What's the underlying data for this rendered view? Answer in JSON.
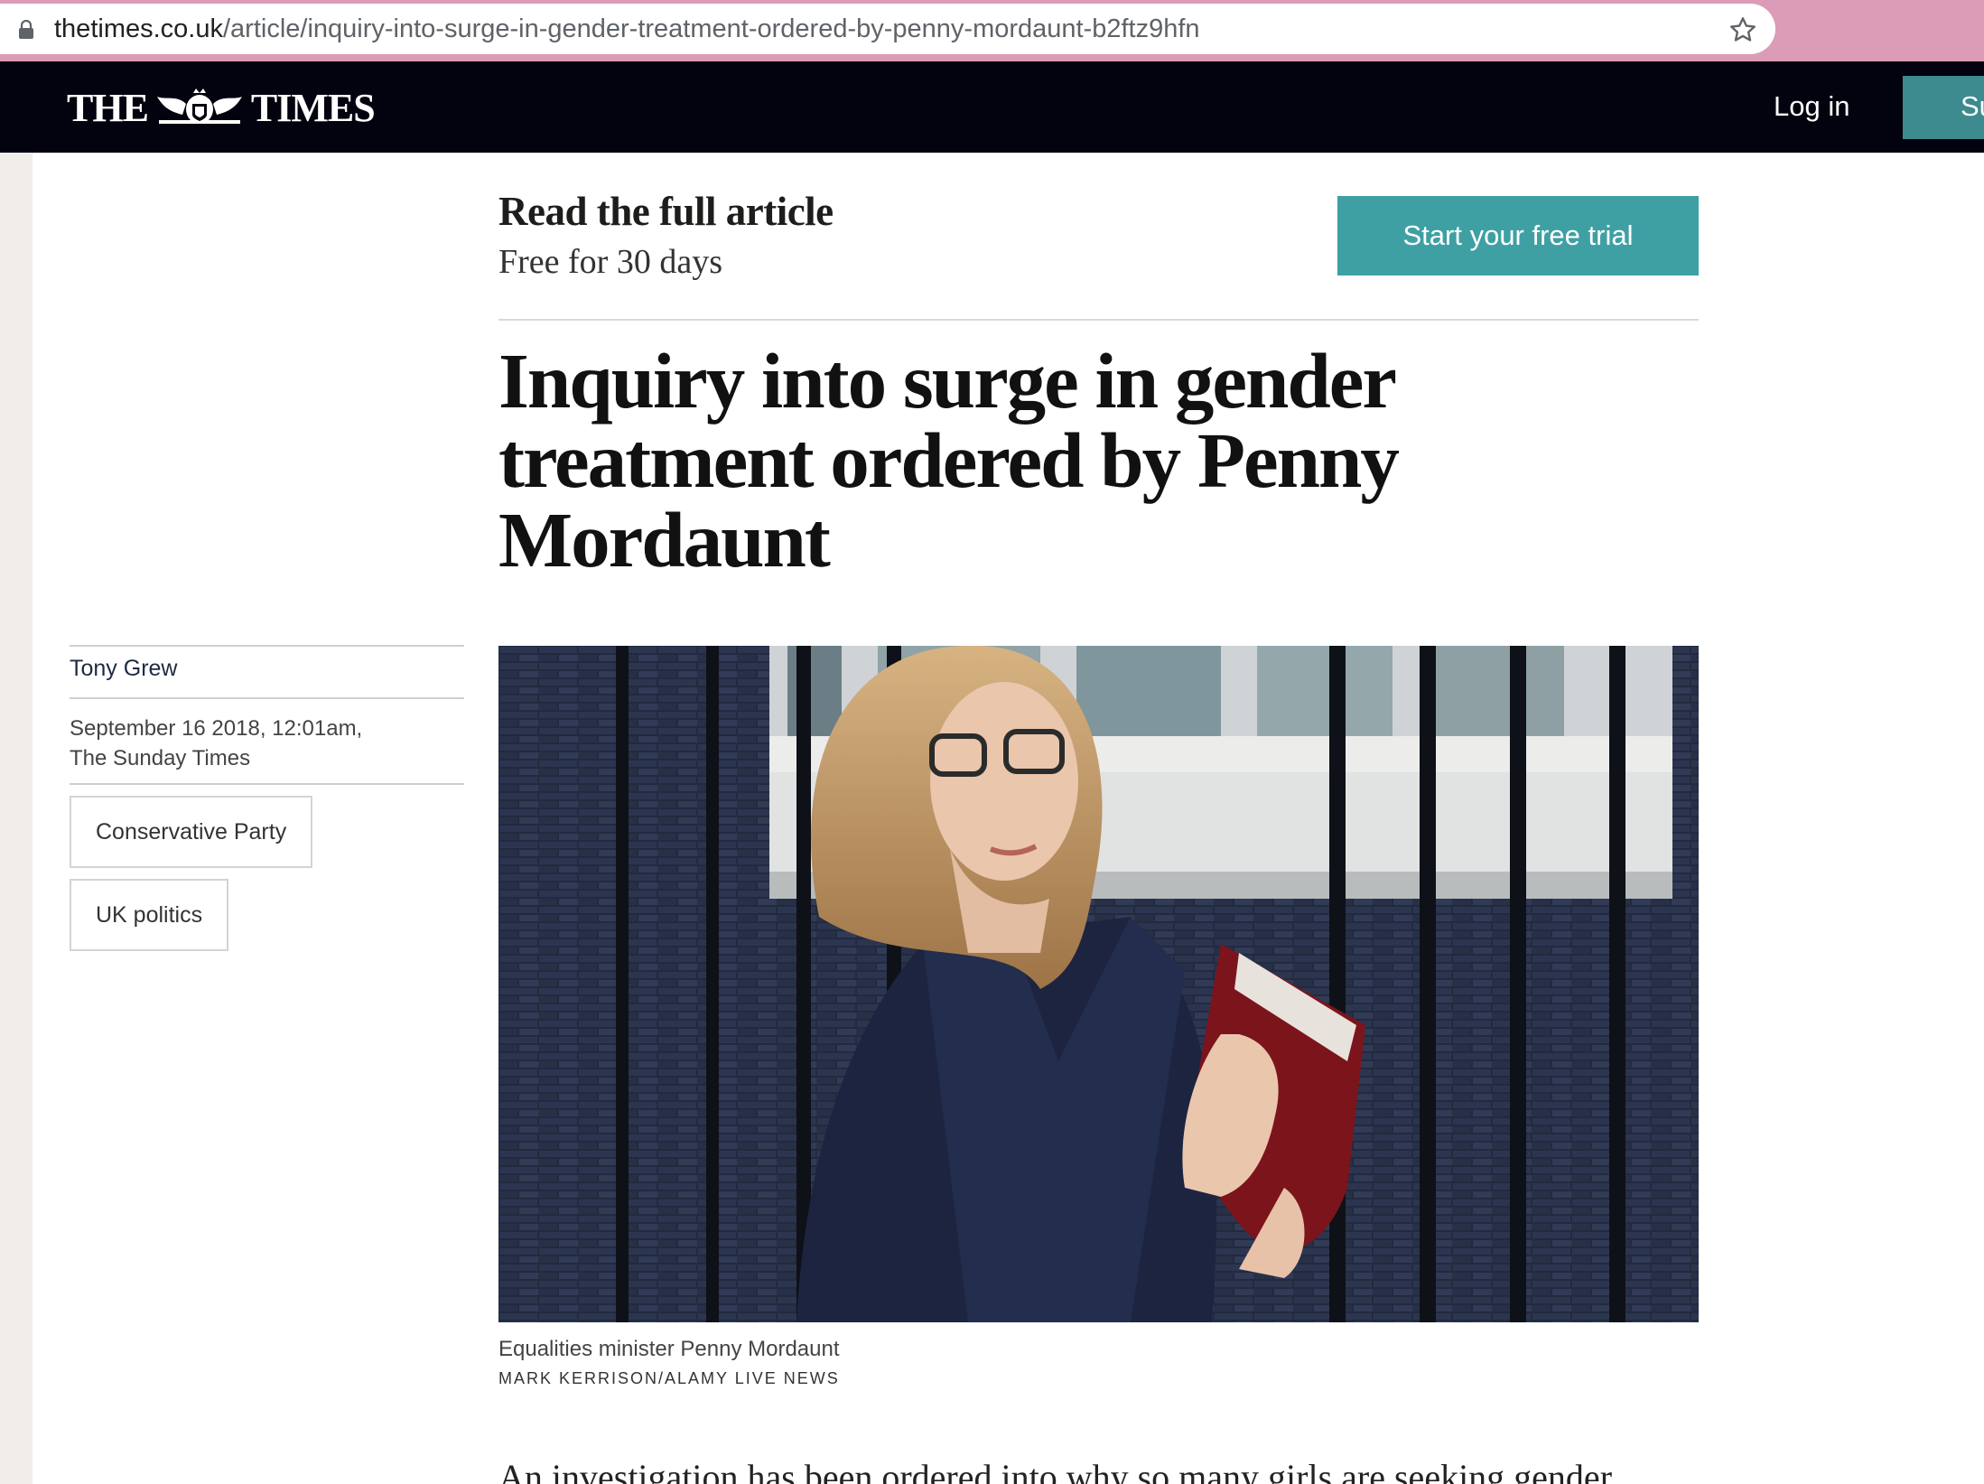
{
  "browser": {
    "url_host": "thetimes.co.uk",
    "url_path": "/article/inquiry-into-surge-in-gender-treatment-ordered-by-penny-mordaunt-b2ftz9hfn",
    "icons": [
      "lock-icon",
      "star-icon"
    ]
  },
  "masthead": {
    "logo_left": "THE",
    "logo_right": "TIMES",
    "login_label": "Log in",
    "subscribe_label": "Su"
  },
  "promo": {
    "title": "Read the full article",
    "subtitle": "Free for 30 days",
    "cta_label": "Start your free trial"
  },
  "article": {
    "headline": "Inquiry into surge in gender treatment ordered by Penny Mordaunt",
    "author": "Tony Grew",
    "date": "September 16 2018, 12:01am,",
    "publication": "The Sunday Times",
    "tags": [
      "Conservative Party",
      "UK politics"
    ],
    "image_caption": "Equalities minister Penny Mordaunt",
    "image_credit": "MARK KERRISON/ALAMY LIVE NEWS",
    "body_start": "An investigation has been ordered into why so many girls are seeking gender"
  },
  "colors": {
    "chrome_bar": "#dc9bb6",
    "masthead_bg": "#03030f",
    "trial_button": "#3fa0a4",
    "subscribe_button": "#3d8a8f"
  }
}
